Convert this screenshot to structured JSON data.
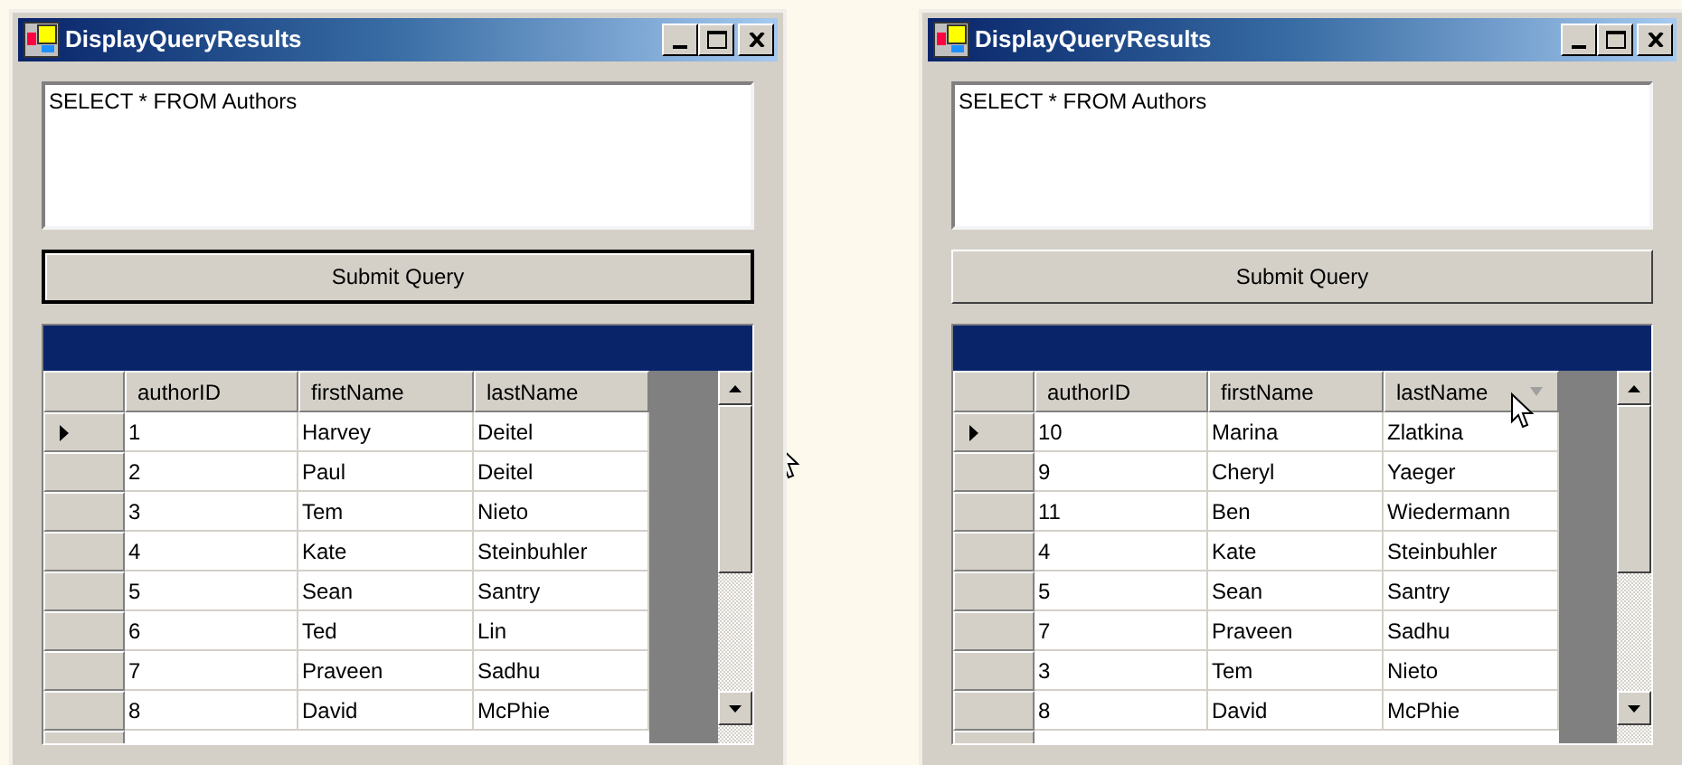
{
  "windows": [
    {
      "title": "DisplayQueryResults",
      "query": "SELECT * FROM Authors",
      "submit_button": {
        "label": "Submit Query",
        "focused": true
      },
      "columns": [
        {
          "label": "authorID",
          "sorted": false
        },
        {
          "label": "firstName",
          "sorted": false
        },
        {
          "label": "lastName",
          "sorted": false
        }
      ],
      "rows": [
        {
          "selected": true,
          "cells": [
            "1",
            "Harvey",
            "Deitel"
          ]
        },
        {
          "selected": false,
          "cells": [
            "2",
            "Paul",
            "Deitel"
          ]
        },
        {
          "selected": false,
          "cells": [
            "3",
            "Tem",
            "Nieto"
          ]
        },
        {
          "selected": false,
          "cells": [
            "4",
            "Kate",
            "Steinbuhler"
          ]
        },
        {
          "selected": false,
          "cells": [
            "5",
            "Sean",
            "Santry"
          ]
        },
        {
          "selected": false,
          "cells": [
            "6",
            "Ted",
            "Lin"
          ]
        },
        {
          "selected": false,
          "cells": [
            "7",
            "Praveen",
            "Sadhu"
          ]
        },
        {
          "selected": false,
          "cells": [
            "8",
            "David",
            "McPhie"
          ]
        }
      ]
    },
    {
      "title": "DisplayQueryResults",
      "query": "SELECT * FROM Authors",
      "submit_button": {
        "label": "Submit Query",
        "focused": false
      },
      "columns": [
        {
          "label": "authorID",
          "sorted": false
        },
        {
          "label": "firstName",
          "sorted": false
        },
        {
          "label": "lastName",
          "sorted": true
        }
      ],
      "rows": [
        {
          "selected": true,
          "cells": [
            "10",
            "Marina",
            "Zlatkina"
          ]
        },
        {
          "selected": false,
          "cells": [
            "9",
            "Cheryl",
            "Yaeger"
          ]
        },
        {
          "selected": false,
          "cells": [
            "11",
            "Ben",
            "Wiedermann"
          ]
        },
        {
          "selected": false,
          "cells": [
            "4",
            "Kate",
            "Steinbuhler"
          ]
        },
        {
          "selected": false,
          "cells": [
            "5",
            "Sean",
            "Santry"
          ]
        },
        {
          "selected": false,
          "cells": [
            "7",
            "Praveen",
            "Sadhu"
          ]
        },
        {
          "selected": false,
          "cells": [
            "3",
            "Tem",
            "Nieto"
          ]
        },
        {
          "selected": false,
          "cells": [
            "8",
            "David",
            "McPhie"
          ]
        }
      ]
    }
  ]
}
